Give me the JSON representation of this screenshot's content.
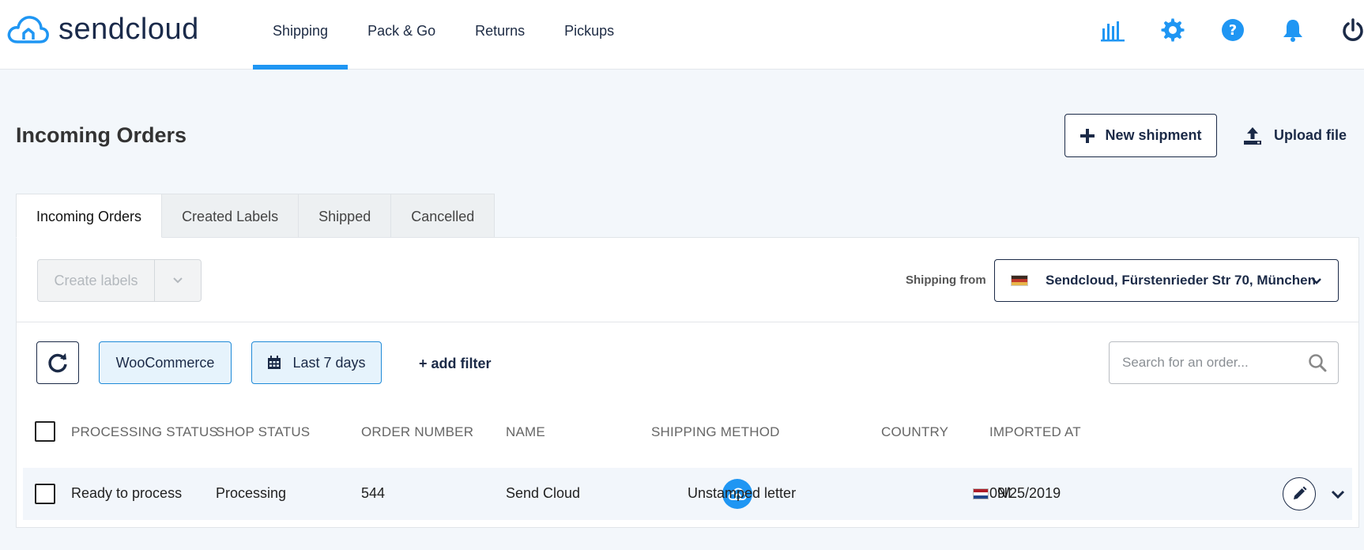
{
  "app": {
    "logo_text": "sendcloud",
    "nav": [
      {
        "label": "Shipping",
        "active": true
      },
      {
        "label": "Pack & Go",
        "active": false
      },
      {
        "label": "Returns",
        "active": false
      },
      {
        "label": "Pickups",
        "active": false
      }
    ],
    "top_icons": [
      "analytics-icon",
      "settings-gear-icon",
      "help-icon",
      "notification-bell-icon",
      "power-icon"
    ],
    "accent_color": "#1f96f3",
    "dark_color": "#1b2a47"
  },
  "page": {
    "title": "Incoming Orders",
    "new_shipment_label": "New shipment",
    "upload_file_label": "Upload file"
  },
  "tabs": [
    {
      "label": "Incoming Orders",
      "active": true
    },
    {
      "label": "Created Labels",
      "active": false
    },
    {
      "label": "Shipped",
      "active": false
    },
    {
      "label": "Cancelled",
      "active": false
    }
  ],
  "toolbar": {
    "create_labels": "Create labels",
    "shipping_from_label": "Shipping from",
    "shipping_from_value": "Sendcloud, Fürstenrieder Str 70, München"
  },
  "filters": {
    "shop_chip": "WooCommerce",
    "date_chip": "Last 7 days",
    "add_filter": "+ add filter",
    "search_placeholder": "Search for an order..."
  },
  "table": {
    "columns": [
      "PROCESSING STATUS",
      "SHOP STATUS",
      "ORDER NUMBER",
      "NAME",
      "SHIPPING METHOD",
      "COUNTRY",
      "IMPORTED AT"
    ],
    "rows": [
      {
        "processing_status": "Ready to process",
        "shop_status": "Processing",
        "order_number": "544",
        "name": "Send Cloud",
        "shipping_method": "Unstamped letter",
        "country": "NL",
        "imported_at": "09/25/2019"
      }
    ]
  }
}
